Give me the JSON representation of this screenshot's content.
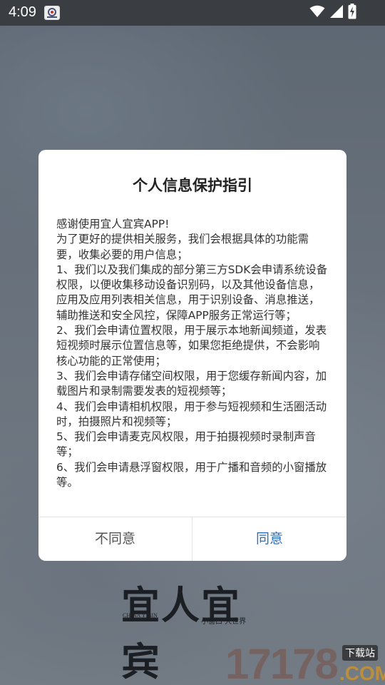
{
  "status_bar": {
    "time": "4:09",
    "icons": [
      "app-notification-icon",
      "wifi-icon",
      "cellular-signal-icon",
      "battery-charging-icon"
    ]
  },
  "dialog": {
    "title": "个人信息保护指引",
    "paragraphs": [
      "感谢使用宜人宜宾APP!",
      "为了更好的提供相关服务，我们会根据具体的功能需要，收集必要的用户信息；",
      "1、我们以及我们集成的部分第三方SDK会申请系统设备权限，以便收集移动设备识别码，以及其他设备信息，应用及应用列表相关信息，用于识别设备、消息推送，辅助推送和安全风控，保障APP服务正常运行等；",
      "2、我们会申请位置权限，用于展示本地新闻频道，发表短视频时展示位置信息等，如果您拒绝提供，不会影响核心功能的正常使用；",
      "3、我们会申请存储空间权限，用于您缓存新闻内容，加载图片和录制需要发表的短视频等；",
      "4、我们会申请相机权限，用于参与短视频和生活圈活动时，拍摄照片和视频等；",
      "5、我们会申请麦克风权限，用于拍摄视频时录制声音等；",
      "6、我们会申请悬浮窗权限，用于广播和音频的小窗播放等。"
    ],
    "disagree_label": "不同意",
    "agree_label": "同意"
  },
  "background": {
    "logo_text": "宜人宜宾",
    "logo_sub": "CHINA YIBIN",
    "slogan": "小窗口 大世界",
    "watermark_digits": "17178",
    "watermark_badge": "下载站",
    "watermark_domain": ".COM"
  },
  "colors": {
    "accent": "#2f6fb5",
    "status_bar": "#3a3d42",
    "dialog_bg": "#ffffff"
  }
}
